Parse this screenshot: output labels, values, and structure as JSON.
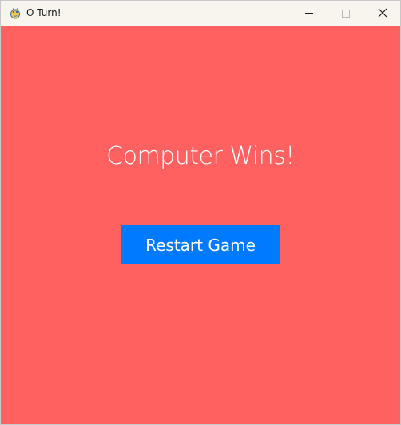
{
  "window": {
    "title": "O Turn!",
    "icon": "pygame-snake-icon"
  },
  "title_buttons": {
    "minimize_icon": "minimize-icon",
    "maximize_icon": "maximize-icon",
    "close_icon": "close-icon"
  },
  "game": {
    "result_message": "Computer Wins!",
    "restart_label": "Restart Game",
    "colors": {
      "background": "#ff6161",
      "button": "#007bff",
      "text": "#ffffff",
      "titlebar": "#f8f5ef"
    }
  }
}
